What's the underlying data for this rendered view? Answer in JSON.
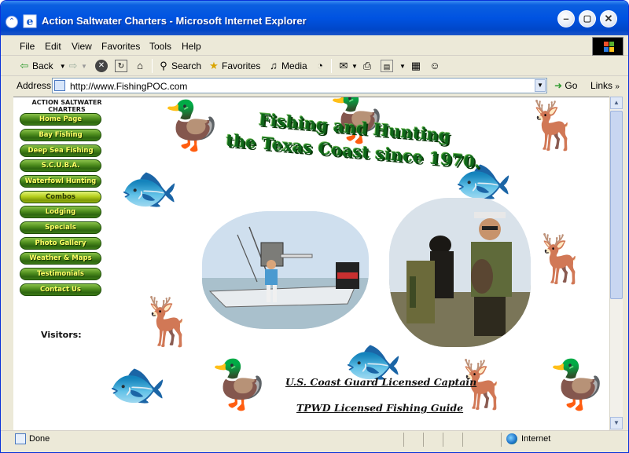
{
  "window": {
    "title": "Action Saltwater Charters - Microsoft Internet Explorer",
    "controls": {
      "minimize": "–",
      "maximize": "▢",
      "close": "✕"
    }
  },
  "menu": [
    "File",
    "Edit",
    "View",
    "Favorites",
    "Tools",
    "Help"
  ],
  "toolbar": {
    "back_label": "Back",
    "search_label": "Search",
    "favorites_label": "Favorites",
    "media_label": "Media"
  },
  "address": {
    "label": "Address",
    "url": "http://www.FishingPOC.com",
    "go_label": "Go",
    "links_label": "Links"
  },
  "page": {
    "sidebar_title_1": "ACTION SALTWATER",
    "sidebar_title_2": "CHARTERS",
    "nav": [
      "Home Page",
      "Bay Fishing",
      "Deep Sea Fishing",
      "S.C.U.B.A.",
      "Waterfowl Hunting",
      "Combos",
      "Lodging",
      "Specials",
      "Photo Gallery",
      "Weather & Maps",
      "Testimonials",
      "Contact Us"
    ],
    "active_nav_index": 5,
    "visitors_label": "Visitors:",
    "headline_1": "Fishing and Hunting",
    "headline_2": "the Texas Coast since 1970.",
    "license_1": "U.S. Coast Guard Licensed Captain",
    "license_2": "TPWD Licensed Fishing Guide"
  },
  "status": {
    "text": "Done",
    "zone": "Internet"
  },
  "colors": {
    "titlebar": "#0053e1",
    "nav_button": "#4d8c1c",
    "nav_text": "#ffff66",
    "headline": "#10661a"
  }
}
